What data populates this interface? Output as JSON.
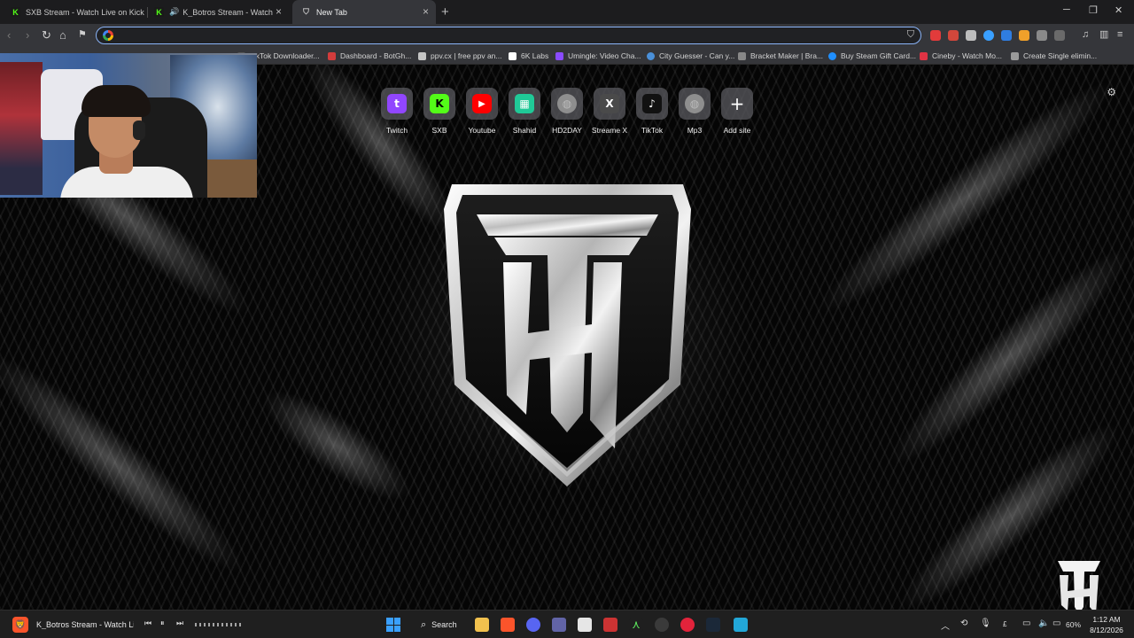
{
  "tabs": [
    {
      "title": "SXB Stream - Watch Live on Kick",
      "icon": "kick-icon",
      "active": false
    },
    {
      "title": "K_Botros Stream - Watch Live",
      "icon": "kick-icon",
      "audio": true,
      "active": false
    },
    {
      "title": "New Tab",
      "icon": "shield-icon",
      "active": true
    }
  ],
  "omnibox": {
    "value": "",
    "placeholder": ""
  },
  "bookmarks": [
    {
      "label": "TikTok Downloader...",
      "color": "#111111"
    },
    {
      "label": "Dashboard - BotGh...",
      "color": "#d33c3c"
    },
    {
      "label": "ppv.cx | free ppv an...",
      "color": "#c5c5c5"
    },
    {
      "label": "6K Labs",
      "color": "#ffffff"
    },
    {
      "label": "Umingle: Video Cha...",
      "color": "#8a4bff"
    },
    {
      "label": "City Guesser - Can y...",
      "color": "#4a90d9"
    },
    {
      "label": "Bracket Maker | Bra...",
      "color": "#888888"
    },
    {
      "label": "Buy Steam Gift Card...",
      "color": "#1f8fff"
    },
    {
      "label": "Cineby - Watch Mo...",
      "color": "#e03344"
    },
    {
      "label": "Create Single elimin...",
      "color": "#9a9a9a"
    }
  ],
  "shortcuts": [
    {
      "label": "Twitch",
      "color": "#9146ff",
      "glyph": "t"
    },
    {
      "label": "SXB",
      "color": "#53fc18",
      "glyph": "K"
    },
    {
      "label": "Youtube",
      "color": "#ff0000",
      "glyph": "▶"
    },
    {
      "label": "Shahid",
      "color": "#20c997",
      "glyph": "▦"
    },
    {
      "label": "HD2DAY",
      "color": "#8e8e8e",
      "glyph": "◍"
    },
    {
      "label": "Streame X",
      "color": "#4a4a4a",
      "glyph": "X"
    },
    {
      "label": "TikTok",
      "color": "#111111",
      "glyph": "♪"
    },
    {
      "label": "Mp3",
      "color": "#8e8e8e",
      "glyph": "◍"
    },
    {
      "label": "Add site",
      "color": "transparent",
      "glyph": "+"
    }
  ],
  "taskbar": {
    "media_title": "K_Botros Stream - Watch Li...",
    "search_label": "Search",
    "battery": "60%",
    "time": "1:12 AM",
    "date": "8/12/2026"
  }
}
